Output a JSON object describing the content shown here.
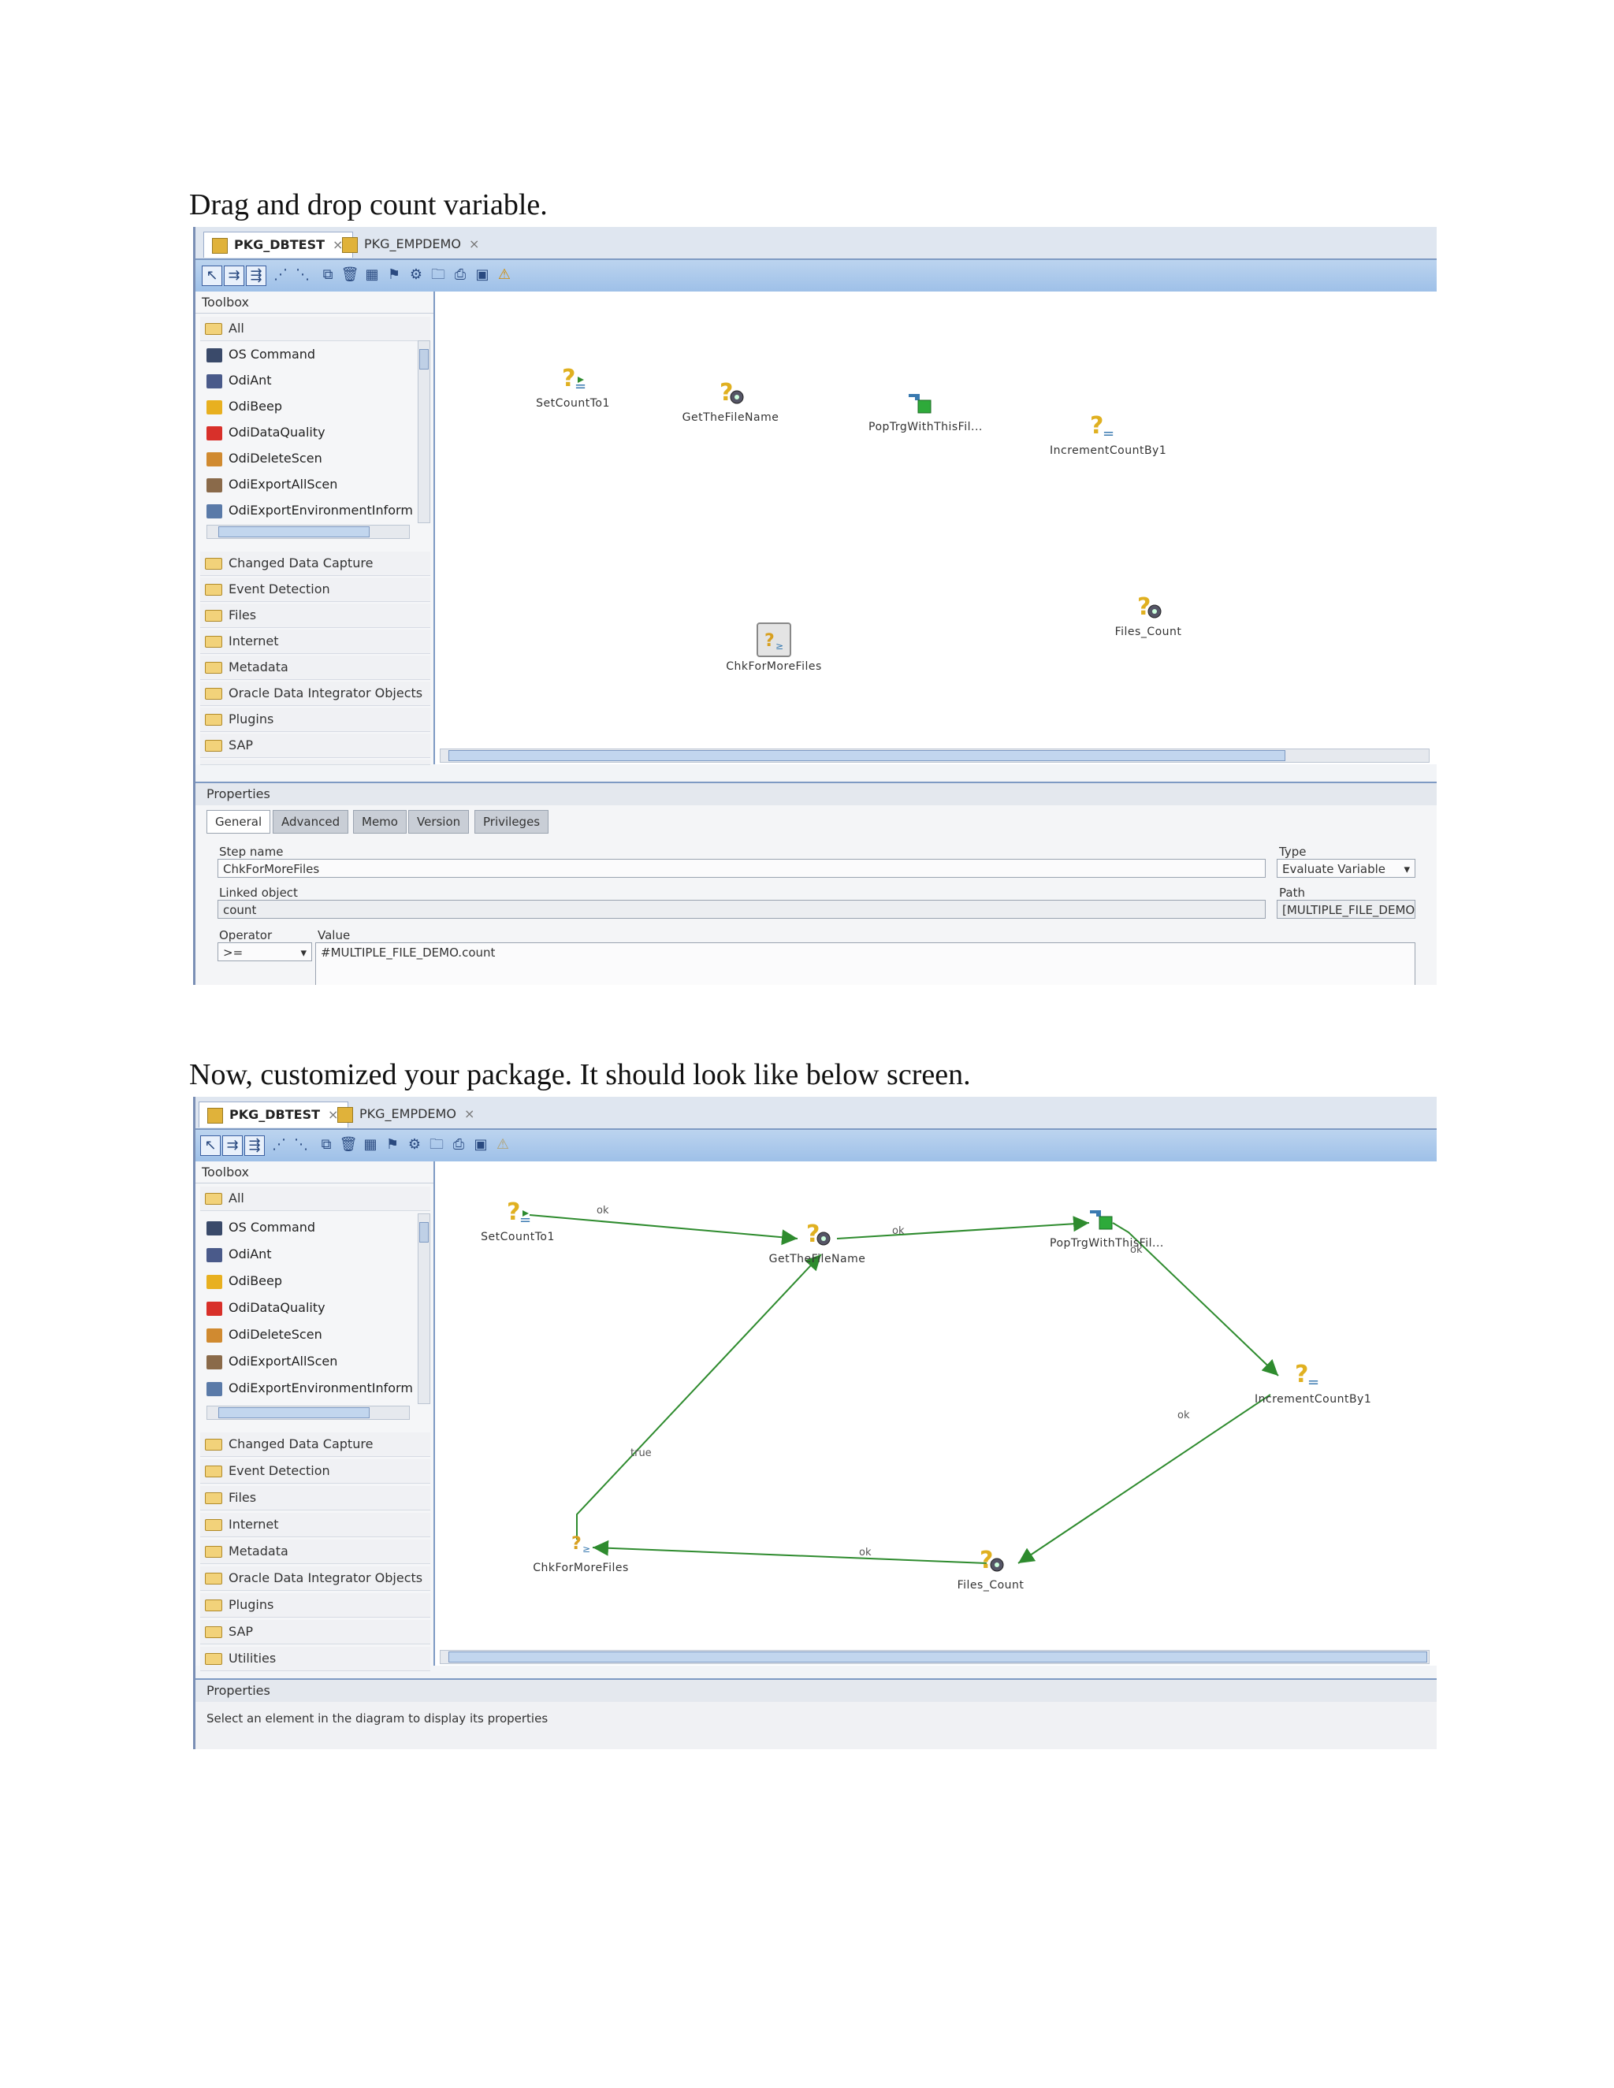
{
  "captions": {
    "first": "Drag and drop count variable.",
    "second": "Now, customized your package. It should look like below screen."
  },
  "tabs": [
    {
      "label": "PKG_DBTEST",
      "close": "×"
    },
    {
      "label": "PKG_EMPDEMO",
      "close": "×"
    }
  ],
  "toolbox": {
    "title": "Toolbox",
    "all_label": "All",
    "tools": [
      "OS Command",
      "OdiAnt",
      "OdiBeep",
      "OdiDataQuality",
      "OdiDeleteScen",
      "OdiExportAllScen",
      "OdiExportEnvironmentInformatic"
    ],
    "categories": [
      "Changed Data Capture",
      "Event Detection",
      "Files",
      "Internet",
      "Metadata",
      "Oracle Data Integrator Objects",
      "Plugins",
      "SAP",
      "Utilities"
    ]
  },
  "nodes": {
    "set_count": "SetCountTo1",
    "get_file": "GetTheFileName",
    "pop_trg": "PopTrgWithThisFil...",
    "increment": "IncrementCountBy1",
    "files_count": "Files_Count",
    "chk_more": "ChkForMoreFiles"
  },
  "links": {
    "ok": "ok",
    "true": "true"
  },
  "properties": {
    "header": "Properties",
    "tabs": [
      "General",
      "Advanced",
      "Memo",
      "Version",
      "Privileges"
    ],
    "step_name_label": "Step name",
    "step_name_value": "ChkForMoreFiles",
    "type_label": "Type",
    "type_value": "Evaluate Variable",
    "linked_object_label": "Linked object",
    "linked_object_value": "count",
    "path_label": "Path",
    "path_value": "[MULTIPLE_FILE_DEMO]",
    "operator_label": "Operator",
    "operator_value": ">=",
    "value_label": "Value",
    "value_value": "#MULTIPLE_FILE_DEMO.count",
    "empty_message": "Select an element in the diagram to display its properties"
  },
  "colors": {
    "link": "#2e8b2e",
    "toolbar": "#a9c7ea",
    "accent": "#7e9ac3"
  }
}
